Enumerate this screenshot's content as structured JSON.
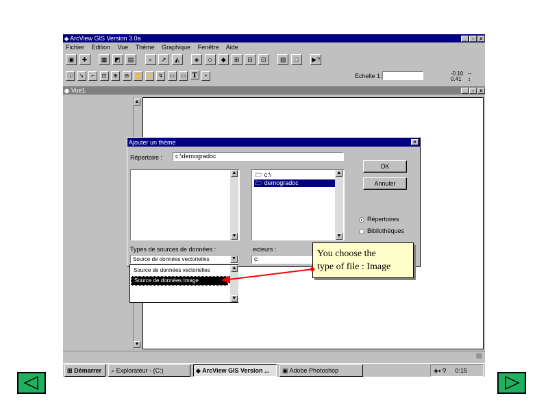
{
  "app": {
    "title": "ArcView GIS Version 3.0a",
    "menu": [
      "Fichier",
      "Edition",
      "Vue",
      "Thème",
      "Graphique",
      "Fenêtre",
      "Aide"
    ],
    "scale_label": "Echelle 1:",
    "scale_value": "",
    "coords": [
      "-0.10",
      "0.41"
    ]
  },
  "view_window": {
    "title": "Vue1"
  },
  "dialog": {
    "title": "Ajouter un thème",
    "directory_label": "Répertoire :",
    "directory_value": "c:\\demogradoc",
    "folders": [
      "c:\\",
      "demogradoc"
    ],
    "selected_folder_index": 1,
    "ok_label": "OK",
    "cancel_label": "Annuler",
    "radio_directories": "Répertoires",
    "radio_libraries": "Bibliothèques",
    "radio_selected": "directories",
    "source_types_label": "Types de sources de données :",
    "source_type_value": "Source de données vectorielles",
    "drive_label": "ecteurs :",
    "drive_value": "c:",
    "dropdown_options": [
      "Source de données vectorielles",
      "Source de données Image"
    ],
    "dropdown_selected_index": 1
  },
  "callout": {
    "text_line1": "You choose the",
    "text_line2": "type of file : Image"
  },
  "taskbar": {
    "start_label": "Démarrer",
    "tasks": [
      "Explorateur - (C:)",
      "ArcView GIS Version ...",
      "Adobe Photoshop"
    ],
    "active_task_index": 1,
    "clock": "0:15"
  },
  "colors": {
    "title_bar": "#000080",
    "desktop": "#c0c0c0",
    "callout_bg": "#ffffcc",
    "arrow": "#ff0000",
    "nav_button": "#20b060"
  }
}
